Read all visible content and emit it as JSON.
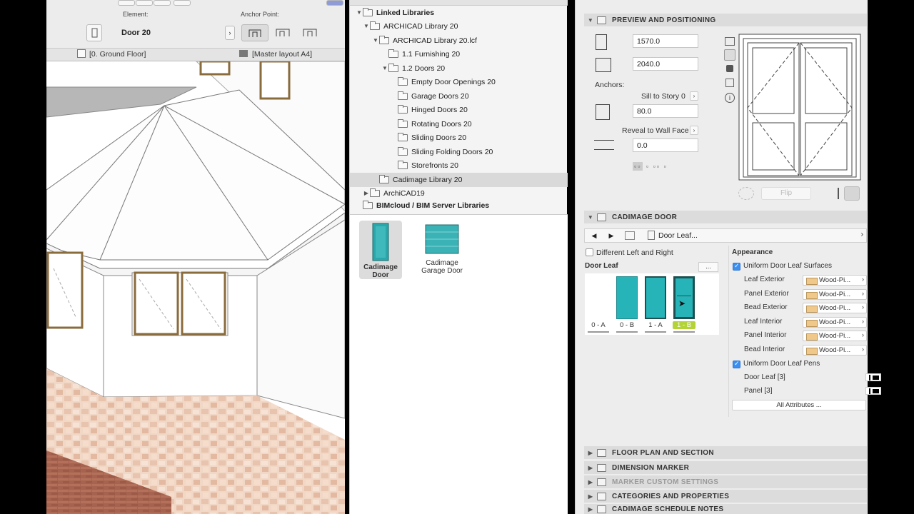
{
  "viewport": {
    "element_label": "Element:",
    "element_value": "Door 20",
    "anchor_label": "Anchor Point:",
    "tab_floor": "[0. Ground Floor]",
    "tab_layout": "[Master layout A4]"
  },
  "library": {
    "tree": [
      {
        "label": "Linked Libraries",
        "bold": true
      },
      {
        "label": "ARCHICAD Library 20"
      },
      {
        "label": "ARCHICAD Library 20.lcf"
      },
      {
        "label": "1.1 Furnishing 20"
      },
      {
        "label": "1.2 Doors 20"
      },
      {
        "label": "Empty Door Openings 20"
      },
      {
        "label": "Garage Doors 20"
      },
      {
        "label": "Hinged Doors 20"
      },
      {
        "label": "Rotating Doors 20"
      },
      {
        "label": "Sliding Doors 20"
      },
      {
        "label": "Sliding Folding Doors 20"
      },
      {
        "label": "Storefronts 20"
      },
      {
        "label": "Cadimage Library 20"
      },
      {
        "label": "ArchiCAD19"
      },
      {
        "label": "BIMcloud / BIM Server Libraries",
        "bold": true
      }
    ],
    "items": [
      {
        "label_1": "Cadimage",
        "label_2": "Door"
      },
      {
        "label_1": "Cadimage",
        "label_2": "Garage Door"
      }
    ]
  },
  "settings": {
    "preview_title": "PREVIEW AND POSITIONING",
    "width": "1570.0",
    "height": "2040.0",
    "anchors_label": "Anchors:",
    "sill_label": "Sill to Story 0",
    "sill_value": "80.0",
    "reveal_label": "Reveal to Wall Face",
    "reveal_value": "0.0",
    "flip_label": "Flip",
    "door_title": "CADIMAGE DOOR",
    "page_select": "Door Leaf...",
    "diff_lr": "Different Left and Right",
    "door_leaf_label": "Door Leaf",
    "more_button": "...",
    "leaf_options": [
      "0 - A",
      "0 - B",
      "1 - A",
      "1 - B"
    ],
    "appearance_label": "Appearance",
    "uniform_surfaces": "Uniform Door Leaf Surfaces",
    "surfaces": [
      {
        "name": "Leaf Exterior",
        "value": "Wood-Pi..."
      },
      {
        "name": "Panel Exterior",
        "value": "Wood-Pi..."
      },
      {
        "name": "Bead Exterior",
        "value": "Wood-Pi..."
      },
      {
        "name": "Leaf Interior",
        "value": "Wood-Pi..."
      },
      {
        "name": "Panel Interior",
        "value": "Wood-Pi..."
      },
      {
        "name": "Bead Interior",
        "value": "Wood-Pi..."
      }
    ],
    "uniform_pens": "Uniform Door Leaf Pens",
    "pens": [
      {
        "name": "Door Leaf [3]"
      },
      {
        "name": "Panel [3]"
      }
    ],
    "all_attributes": "All Attributes ...",
    "collapsed_sections": [
      "FLOOR PLAN AND SECTION",
      "DIMENSION MARKER",
      "MARKER CUSTOM SETTINGS",
      "CATEGORIES AND PROPERTIES",
      "CADIMAGE SCHEDULE NOTES"
    ]
  }
}
